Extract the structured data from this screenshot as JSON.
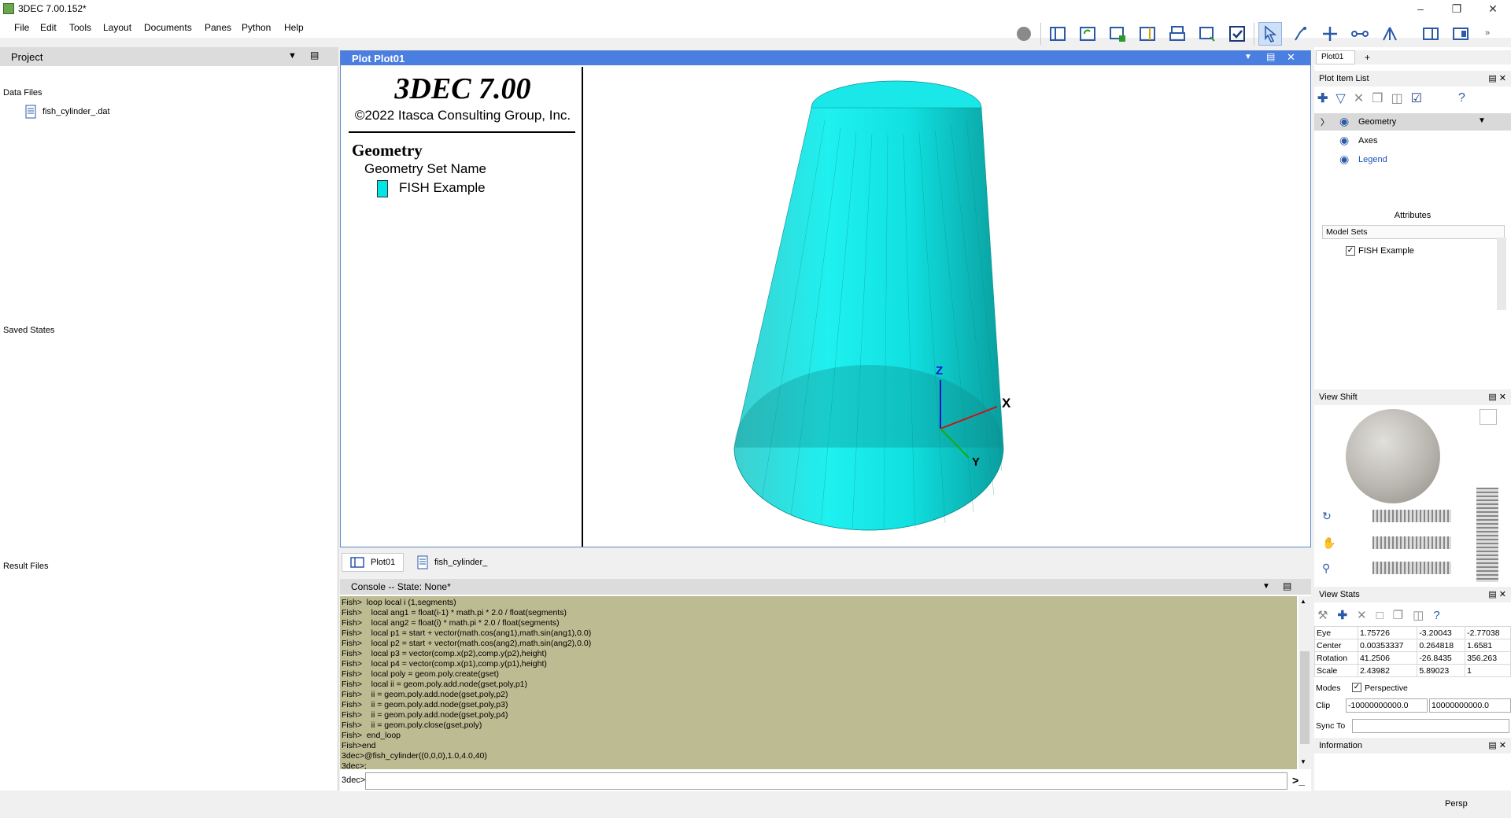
{
  "window": {
    "title": "3DEC 7.00.152*"
  },
  "menu": [
    "File",
    "Edit",
    "Tools",
    "Layout",
    "Documents",
    "Panes",
    "Python",
    "Help"
  ],
  "project": {
    "header": "Project",
    "data_files_label": "Data Files",
    "data_file": "fish_cylinder_.dat",
    "saved_states_label": "Saved States",
    "result_files_label": "Result Files"
  },
  "plot": {
    "header": "Plot Plot01",
    "legend": {
      "app": "3DEC 7.00",
      "copyright": "©2022 Itasca Consulting Group, Inc.",
      "section": "Geometry",
      "subsection": "Geometry Set Name",
      "item": "FISH Example",
      "item_color": "#00e5e5"
    },
    "axes": {
      "x": "X",
      "y": "Y",
      "z": "Z"
    }
  },
  "tabs": [
    "Plot01",
    "fish_cylinder_"
  ],
  "console": {
    "header": "Console -- State: None*",
    "lines": [
      "Fish>  loop local i (1,segments)",
      "Fish>    local ang1 = float(i-1) * math.pi * 2.0 / float(segments)",
      "Fish>    local ang2 = float(i) * math.pi * 2.0 / float(segments)",
      "Fish>    local p1 = start + vector(math.cos(ang1),math.sin(ang1),0.0)",
      "Fish>    local p2 = start + vector(math.cos(ang2),math.sin(ang2),0.0)",
      "Fish>    local p3 = vector(comp.x(p2),comp.y(p2),height)",
      "Fish>    local p4 = vector(comp.x(p1),comp.y(p1),height)",
      "Fish>    local poly = geom.poly.create(gset)",
      "Fish>    local ii = geom.poly.add.node(gset,poly,p1)",
      "Fish>    ii = geom.poly.add.node(gset,poly,p2)",
      "Fish>    ii = geom.poly.add.node(gset,poly,p3)",
      "Fish>    ii = geom.poly.add.node(gset,poly,p4)",
      "Fish>    ii = geom.poly.close(gset,poly)",
      "Fish>  end_loop",
      "Fish>end",
      "3dec>@fish_cylinder((0,0,0),1.0,4.0,40)",
      "3dec>;"
    ],
    "prompt": "3dec>"
  },
  "right": {
    "tab": "Plot01",
    "tab_add": "+",
    "plot_item_list": "Plot Item List",
    "items": [
      "Geometry",
      "Axes",
      "Legend"
    ],
    "attributes": "Attributes",
    "model_sets": "Model Sets",
    "model_set_item": "FISH Example",
    "view_shift": "View Shift",
    "view_stats": "View Stats",
    "stats": {
      "eye": [
        "Eye",
        "1.75726",
        "-3.20043",
        "-2.77038"
      ],
      "center": [
        "Center",
        "0.00353337",
        "0.264818",
        "1.6581"
      ],
      "rotation": [
        "Rotation",
        "41.2506",
        "-26.8435",
        "356.263"
      ],
      "scale": [
        "Scale",
        "2.43982",
        "5.89023",
        "1"
      ]
    },
    "modes_label": "Modes",
    "perspective_label": "Perspective",
    "clip_label": "Clip",
    "clip_min": "-10000000000.0",
    "clip_max": "10000000000.0",
    "sync_label": "Sync To",
    "information": "Information"
  },
  "status": "Persp"
}
